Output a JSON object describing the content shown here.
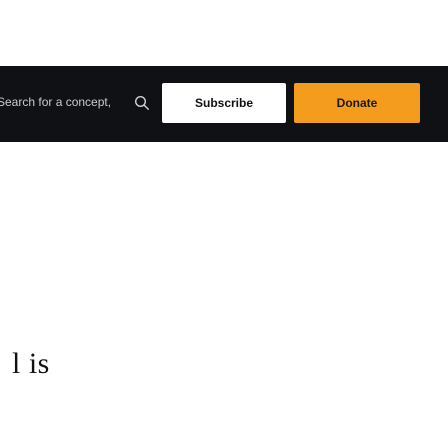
{
  "header": {
    "search": {
      "placeholder": "Search for a concept, art or article..."
    },
    "search_icon": "search-icon",
    "subscribe_label": "Subscribe",
    "donate_label": "Donate"
  },
  "body": {
    "fragment_text": "l is"
  },
  "colors": {
    "header_background": "#0f1114",
    "donate_accent": "#f39c1e",
    "subscribe_background": "#ffffff"
  }
}
